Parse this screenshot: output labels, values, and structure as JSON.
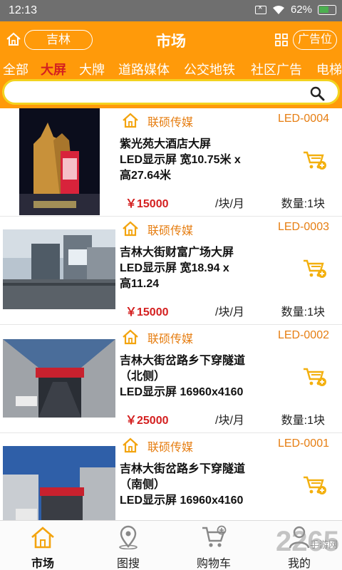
{
  "status": {
    "time": "12:13",
    "battery": "62%",
    "battery_level": 0.62
  },
  "header": {
    "city": "吉林",
    "title": "市场",
    "ad_button": "广告位"
  },
  "tabs": [
    {
      "label": "全部"
    },
    {
      "label": "大屏"
    },
    {
      "label": "大牌"
    },
    {
      "label": "道路媒体"
    },
    {
      "label": "公交地铁"
    },
    {
      "label": "社区广告"
    },
    {
      "label": "电梯"
    }
  ],
  "active_tab": "大屏",
  "search": {
    "value": "",
    "placeholder": ""
  },
  "listings": [
    {
      "company": "联硕传媒",
      "code": "LED-0004",
      "title_lines": [
        "紫光苑大酒店大屏",
        "LED显示屏 宽10.75米 x",
        "高27.64米"
      ],
      "price": "￥15000",
      "unit": "/块/月",
      "qty": "数量:1块"
    },
    {
      "company": "联硕传媒",
      "code": "LED-0003",
      "title_lines": [
        "吉林大街财富广场大屏",
        "LED显示屏 宽18.94 x",
        "高11.24"
      ],
      "price": "￥15000",
      "unit": "/块/月",
      "qty": "数量:1块"
    },
    {
      "company": "联硕传媒",
      "code": "LED-0002",
      "title_lines": [
        "吉林大街岔路乡下穿隧道",
        "（北侧）",
        "LED显示屏 16960x4160"
      ],
      "price": "￥25000",
      "unit": "/块/月",
      "qty": "数量:1块"
    },
    {
      "company": "联硕传媒",
      "code": "LED-0001",
      "title_lines": [
        "吉林大街岔路乡下穿隧道",
        "（南侧）",
        "LED显示屏 16960x4160"
      ],
      "price": "",
      "unit": "",
      "qty": ""
    }
  ],
  "bottom_nav": [
    {
      "label": "市场",
      "icon": "home-icon"
    },
    {
      "label": "图搜",
      "icon": "map-pin-icon"
    },
    {
      "label": "购物车",
      "icon": "cart-icon"
    },
    {
      "label": "我的",
      "icon": "user-icon"
    }
  ],
  "watermark": {
    "text": "2265",
    "sub": "手游网"
  },
  "colors": {
    "accent": "#ff9a0a",
    "price": "#d42020",
    "company": "#e67e12",
    "search_border": "#f3d320"
  }
}
